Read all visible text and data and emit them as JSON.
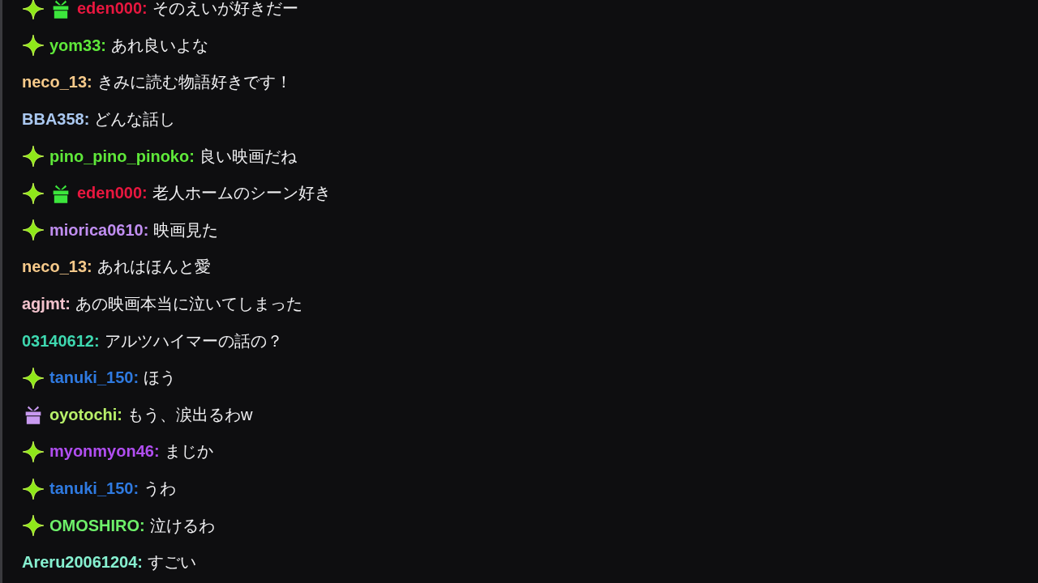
{
  "messages": [
    {
      "badges": [
        {
          "kind": "sparkle"
        },
        {
          "kind": "gift",
          "color": "#3ce63c"
        }
      ],
      "name": "eden000:",
      "color": "#e8173f",
      "text": "そのえいが好きだー"
    },
    {
      "badges": [
        {
          "kind": "sparkle"
        }
      ],
      "name": "yom33:",
      "color": "#5fe83a",
      "text": "あれ良いよな"
    },
    {
      "name": "neco_13:",
      "color": "#f5c98a",
      "text": "きみに読む物語好きです！"
    },
    {
      "name": "BBA358:",
      "color": "#aac8f0",
      "text": "どんな話し"
    },
    {
      "badges": [
        {
          "kind": "sparkle"
        }
      ],
      "name": "pino_pino_pinoko:",
      "color": "#5fe83a",
      "text": "良い映画だね"
    },
    {
      "badges": [
        {
          "kind": "sparkle"
        },
        {
          "kind": "gift",
          "color": "#3ce63c"
        }
      ],
      "name": "eden000:",
      "color": "#e8173f",
      "text": "老人ホームのシーン好き"
    },
    {
      "badges": [
        {
          "kind": "sparkle"
        }
      ],
      "name": "miorica0610:",
      "color": "#c08ef0",
      "text": "映画見た"
    },
    {
      "name": "neco_13:",
      "color": "#f5c98a",
      "text": "あれはほんと愛"
    },
    {
      "name": "agjmt:",
      "color": "#f2c2cc",
      "text": "あの映画本当に泣いてしまった"
    },
    {
      "name": "03140612:",
      "color": "#3ed8b0",
      "text": "アルツハイマーの話の？"
    },
    {
      "badges": [
        {
          "kind": "sparkle"
        }
      ],
      "name": "tanuki_150:",
      "color": "#2f7ae0",
      "text": "ほう"
    },
    {
      "badges": [
        {
          "kind": "gift",
          "color": "#c89af0"
        }
      ],
      "name": "oyotochi:",
      "color": "#b8f06a",
      "text": "もう、涙出るわw"
    },
    {
      "badges": [
        {
          "kind": "sparkle"
        }
      ],
      "name": "myonmyon46:",
      "color": "#b04ef0",
      "text": "まじか"
    },
    {
      "badges": [
        {
          "kind": "sparkle"
        }
      ],
      "name": "tanuki_150:",
      "color": "#2f7ae0",
      "text": "うわ"
    },
    {
      "badges": [
        {
          "kind": "sparkle"
        }
      ],
      "name": "OMOSHIRO:",
      "color": "#6ef06a",
      "text": "泣けるわ"
    },
    {
      "name": "Areru20061204:",
      "color": "#86f0d0",
      "text": "すごい"
    }
  ]
}
